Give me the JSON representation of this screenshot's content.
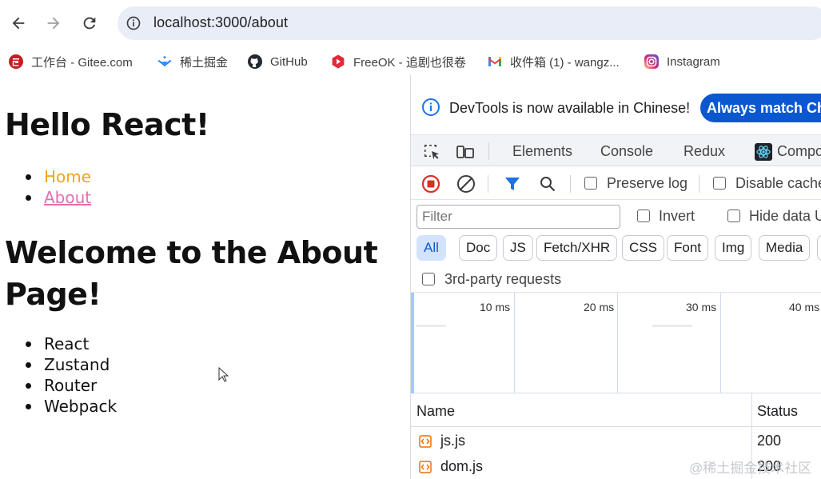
{
  "browser": {
    "url": "localhost:3000/about",
    "icons": {
      "back": "arrow-left-icon",
      "forward": "arrow-right-icon",
      "reload": "reload-icon",
      "site_info": "info-icon"
    }
  },
  "bookmarks": [
    {
      "label": "工作台 - Gitee.com",
      "icon": "gitee-icon",
      "color": "#c71d23"
    },
    {
      "label": "稀土掘金",
      "icon": "juejin-icon",
      "color": "#1e80ff"
    },
    {
      "label": "GitHub",
      "icon": "github-icon",
      "color": "#24292f"
    },
    {
      "label": "FreeOK - 追剧也很卷",
      "icon": "freeok-icon",
      "color": "#e5293b"
    },
    {
      "label": "收件箱 (1) - wangz...",
      "icon": "gmail-icon",
      "color": "#ea4335"
    },
    {
      "label": "Instagram",
      "icon": "instagram-icon",
      "color": "#d6249f"
    }
  ],
  "page": {
    "title": "Hello React!",
    "nav": [
      {
        "label": "Home",
        "color": "#f0a41f"
      },
      {
        "label": "About",
        "color": "#e36fb2"
      }
    ],
    "heading": "Welcome to the About Page!",
    "tech": [
      "React",
      "Zustand",
      "Router",
      "Webpack"
    ]
  },
  "devtools": {
    "banner": {
      "text": "DevTools is now available in Chinese!",
      "button": "Always match Chrome's language"
    },
    "tabs": [
      "Elements",
      "Console",
      "Redux",
      "Components"
    ],
    "network": {
      "preserve_log": "Preserve log",
      "disable_cache": "Disable cache",
      "filter_placeholder": "Filter",
      "invert": "Invert",
      "hide_data_urls": "Hide data URLs",
      "types": [
        "All",
        "Doc",
        "JS",
        "Fetch/XHR",
        "CSS",
        "Font",
        "Img",
        "Media"
      ],
      "active_type": "All",
      "third_party": "3rd-party requests",
      "timeline_ticks": [
        "10 ms",
        "20 ms",
        "30 ms",
        "40 ms"
      ],
      "columns": [
        "Name",
        "Status"
      ],
      "rows": [
        {
          "name": "js.js",
          "status": "200"
        },
        {
          "name": "dom.js",
          "status": "200"
        }
      ]
    }
  },
  "watermark": "@稀土掘金技术社区",
  "accent_color": "#0b57d0"
}
